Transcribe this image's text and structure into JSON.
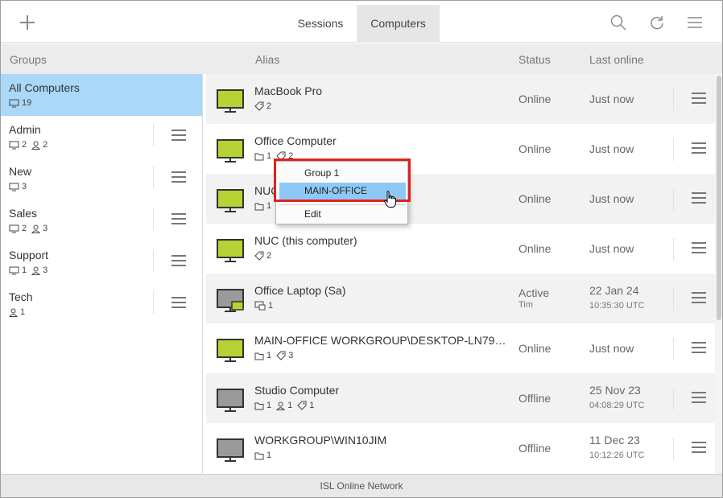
{
  "app": {
    "footer": "ISL Online Network"
  },
  "tabs": {
    "sessions": "Sessions",
    "computers": "Computers"
  },
  "columns": {
    "groups": "Groups",
    "alias": "Alias",
    "status": "Status",
    "last_online": "Last online"
  },
  "colors": {
    "online_green": "#b5d334",
    "offline_gray": "#9a9a9a",
    "selected_blue": "#a9d8f8",
    "highlight_blue": "#8ec9f6",
    "annotation_red": "#e2211c"
  },
  "groups": [
    {
      "name": "All Computers",
      "computers": "19",
      "users": "",
      "selected": true
    },
    {
      "name": "Admin",
      "computers": "2",
      "users": "2"
    },
    {
      "name": "New",
      "computers": "3",
      "users": ""
    },
    {
      "name": "Sales",
      "computers": "2",
      "users": "3"
    },
    {
      "name": "Support",
      "computers": "1",
      "users": "3"
    },
    {
      "name": "Tech",
      "computers": "",
      "users": "1"
    }
  ],
  "computers": [
    {
      "alias": "MacBook Pro",
      "folders": "",
      "users": "",
      "tags": "2",
      "status": "Online",
      "status_sub": "",
      "last": "Just now",
      "last_sub": "",
      "state": "online"
    },
    {
      "alias": "Office Computer",
      "folders": "1",
      "users": "",
      "tags": "2",
      "status": "Online",
      "status_sub": "",
      "last": "Just now",
      "last_sub": "",
      "state": "online"
    },
    {
      "alias": "NUC",
      "folders": "1",
      "users": "",
      "tags": "",
      "status": "Online",
      "status_sub": "",
      "last": "Just now",
      "last_sub": "",
      "state": "online"
    },
    {
      "alias": "NUC (this computer)",
      "folders": "",
      "users": "",
      "tags": "2",
      "status": "Online",
      "status_sub": "",
      "last": "Just now",
      "last_sub": "",
      "state": "online"
    },
    {
      "alias": "Office Laptop (Sa)",
      "sessions": "1",
      "status": "Active",
      "status_sub": "Tim",
      "last": "22 Jan 24",
      "last_sub": "10:35:30 UTC",
      "state": "active"
    },
    {
      "alias": "MAIN-OFFICE WORKGROUP\\DESKTOP-LN79…",
      "folders": "1",
      "users": "",
      "tags": "3",
      "status": "Online",
      "status_sub": "",
      "last": "Just now",
      "last_sub": "",
      "state": "online"
    },
    {
      "alias": "Studio Computer",
      "folders": "1",
      "users": "1",
      "tags": "1",
      "status": "Offline",
      "status_sub": "",
      "last": "25 Nov 23",
      "last_sub": "04:08:29 UTC",
      "state": "offline"
    },
    {
      "alias": "WORKGROUP\\WIN10JIM",
      "folders": "1",
      "users": "",
      "tags": "",
      "status": "Offline",
      "status_sub": "",
      "last": "11 Dec 23",
      "last_sub": "10:12:26 UTC",
      "state": "offline"
    }
  ],
  "context_menu": {
    "items": [
      "Group 1",
      "MAIN-OFFICE",
      "Edit"
    ],
    "highlighted": "MAIN-OFFICE"
  },
  "icons": {
    "add": "plus-icon",
    "search": "search-icon",
    "refresh": "refresh-icon",
    "menu": "hamburger-menu-icon"
  }
}
